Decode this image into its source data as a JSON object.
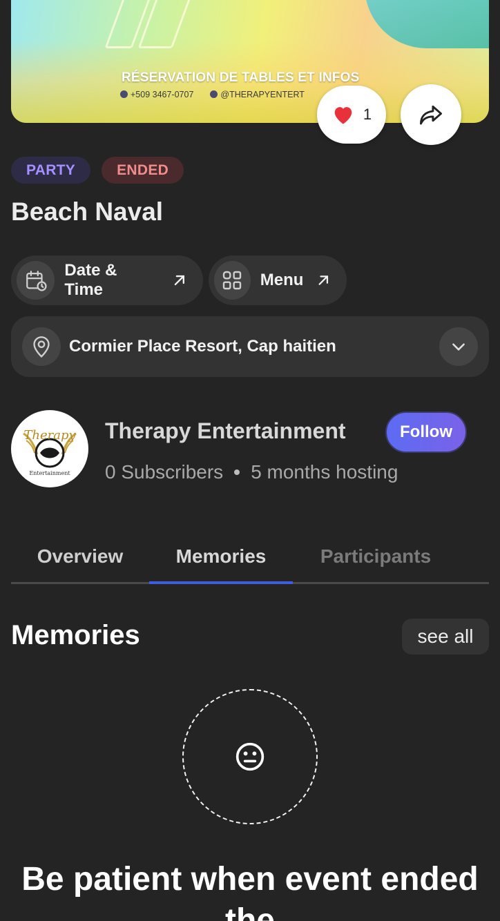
{
  "banner": {
    "title": "RÉSERVATION DE TABLES ET INFOS",
    "phone": "+509 3467-0707",
    "instagram": "@THERAPYENTERT"
  },
  "likes": {
    "count": "1",
    "icon": "heart-icon"
  },
  "share": {
    "icon": "share-arrow-icon"
  },
  "tags": {
    "category": "PARTY",
    "status": "ENDED"
  },
  "event": {
    "title": "Beach Naval"
  },
  "chips": {
    "datetime": {
      "label": "Date & Time",
      "icon": "calendar-clock-icon"
    },
    "menu": {
      "label": "Menu",
      "icon": "grid-icon"
    }
  },
  "location": {
    "text": "Cormier Place Resort, Cap haitien",
    "icon": "location-pin-icon"
  },
  "host": {
    "name": "Therapy Entertainment",
    "follow_label": "Follow",
    "subscribers": "0 Subscribers",
    "hosting": "5 months hosting"
  },
  "tabs": [
    {
      "label": "Overview"
    },
    {
      "label": "Memories"
    },
    {
      "label": "Participants"
    }
  ],
  "memories": {
    "title": "Memories",
    "see_all": "see all",
    "empty_text": "Be patient when event ended the"
  },
  "colors": {
    "background": "#242424",
    "accent": "#3f5de0",
    "party_tag": "#a690ff",
    "ended_tag": "#f08c8c",
    "like_heart": "#e8313a"
  }
}
